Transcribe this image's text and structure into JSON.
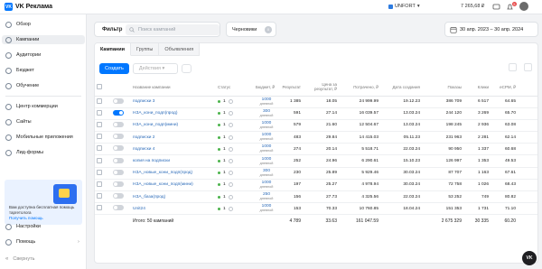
{
  "app": {
    "logo_mark": "VK",
    "title": "VK Реклама",
    "account": "UNFORT",
    "balance": "7 265,68 ₽",
    "notifications_count": "5"
  },
  "sidebar": {
    "items": [
      {
        "label": "Обзор",
        "icon": "home-icon"
      },
      {
        "label": "Кампании",
        "icon": "campaigns-icon",
        "active": true
      },
      {
        "label": "Аудитории",
        "icon": "audience-icon"
      },
      {
        "label": "Бюджет",
        "icon": "budget-icon"
      },
      {
        "label": "Обучение",
        "icon": "education-icon"
      },
      {
        "label": "Центр коммерции",
        "icon": "commerce-icon"
      },
      {
        "label": "Сайты",
        "icon": "sites-icon"
      },
      {
        "label": "Мобильные приложения",
        "icon": "apps-icon"
      },
      {
        "label": "Лид-формы",
        "icon": "leadforms-icon"
      }
    ],
    "promo_text": "Вам доступна бесплатная помощь таргетолога",
    "promo_link": "Получить помощь",
    "bottom": [
      {
        "label": "Настройки",
        "icon": "settings-icon"
      },
      {
        "label": "Помощь",
        "icon": "help-icon"
      },
      {
        "label": "Свернуть",
        "icon": "collapse-icon"
      }
    ]
  },
  "filters": {
    "filter_label": "Фильтр",
    "search_placeholder": "Поиск кампаний",
    "drafts_label": "Черновики",
    "drafts_count": "0",
    "date_range": "30 апр. 2023 – 30 апр. 2024"
  },
  "tabs": [
    "Кампании",
    "Группы",
    "Объявления"
  ],
  "toolbar": {
    "create_label": "Создать",
    "actions_label": "Действия"
  },
  "table": {
    "columns": [
      "Название кампании",
      "Статус",
      "Бюджет, ₽",
      "Результат",
      "Цена за результат, ₽",
      "Потрачено, ₽",
      "Дата создания",
      "Показы",
      "Клики",
      "eCPM, ₽"
    ],
    "budget_period": "дневной",
    "rows": [
      {
        "on": false,
        "name": "подписки 3",
        "status": "1",
        "status_color": "#4bb34b",
        "budget": "1000",
        "result": "1 385",
        "cpr": "18.05",
        "spent": "24 999.99",
        "created": "19.12.23",
        "shows": "386 709",
        "clicks": "6 517",
        "ecpm": "64.65"
      },
      {
        "on": true,
        "name": "НЗА_кони_подп(прод)",
        "status": "1",
        "status_color": "#4bb34b",
        "budget": "300",
        "result": "591",
        "cpr": "27.14",
        "spent": "16 039.57",
        "created": "13.03.24",
        "shows": "244 120",
        "clicks": "3 269",
        "ecpm": "65.70"
      },
      {
        "on": false,
        "name": "НЗА_кони_подп(мини)",
        "status": "1",
        "status_color": "#4bb34b",
        "budget": "1000",
        "result": "579",
        "cpr": "21.60",
        "spent": "12 504.67",
        "created": "13.03.24",
        "shows": "198 245",
        "clicks": "2 936",
        "ecpm": "63.08"
      },
      {
        "on": false,
        "name": "подписки 2",
        "status": "1",
        "status_color": "#4bb34b",
        "budget": "1000",
        "result": "483",
        "cpr": "29.84",
        "spent": "14 415.03",
        "created": "05.11.23",
        "shows": "231 963",
        "clicks": "2 281",
        "ecpm": "62.14"
      },
      {
        "on": false,
        "name": "подписки 4",
        "status": "1",
        "status_color": "#4bb34b",
        "budget": "1000",
        "result": "274",
        "cpr": "20.14",
        "spent": "5 518.71",
        "created": "22.03.24",
        "shows": "90 950",
        "clicks": "1 337",
        "ecpm": "60.68"
      },
      {
        "on": false,
        "name": "копия на подписки",
        "status": "1",
        "status_color": "#4bb34b",
        "budget": "1000",
        "result": "252",
        "cpr": "24.96",
        "spent": "6 290.61",
        "created": "15.10.23",
        "shows": "126 997",
        "clicks": "1 353",
        "ecpm": "49.53"
      },
      {
        "on": false,
        "name": "НЗА_новые_кони_подп(прод)",
        "status": "1",
        "status_color": "#4bb34b",
        "budget": "300",
        "result": "230",
        "cpr": "25.89",
        "spent": "5 929.46",
        "created": "30.03.24",
        "shows": "87 707",
        "clicks": "1 163",
        "ecpm": "67.61"
      },
      {
        "on": false,
        "name": "НЗА_новые_кони_подп(мини)",
        "status": "1",
        "status_color": "#4bb34b",
        "budget": "1000",
        "result": "197",
        "cpr": "25.27",
        "spent": "4 978.94",
        "created": "30.03.24",
        "shows": "72 758",
        "clicks": "1 026",
        "ecpm": "68.43"
      },
      {
        "on": false,
        "name": "НЗА_база(прод)",
        "status": "1",
        "status_color": "#4bb34b",
        "budget": "250",
        "result": "156",
        "cpr": "27.73",
        "spent": "4 325.56",
        "created": "22.03.24",
        "shows": "53 252",
        "clicks": "749",
        "ecpm": "80.82"
      },
      {
        "on": false,
        "name": "Unit24",
        "status": "1",
        "status_color": "#4bb34b",
        "budget": "1000",
        "result": "153",
        "cpr": "70.33",
        "spent": "10 760.85",
        "created": "18.04.24",
        "shows": "151 353",
        "clicks": "1 731",
        "ecpm": "71.10"
      }
    ],
    "total": {
      "label": "Итого: 50 кампаний",
      "result": "4 789",
      "cpr": "33.63",
      "spent": "161 047.59",
      "shows": "2 675 329",
      "clicks": "30 335",
      "ecpm": "60.20"
    }
  }
}
